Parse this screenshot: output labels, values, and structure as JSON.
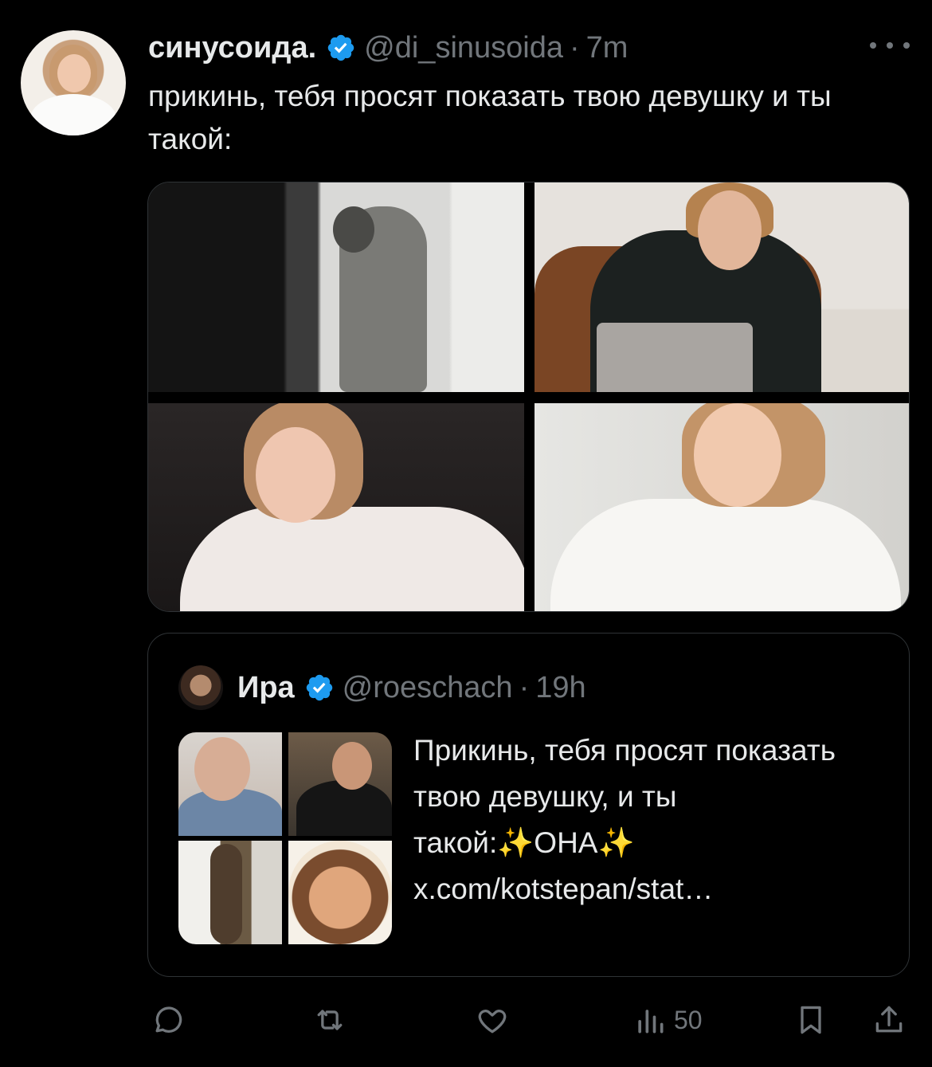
{
  "tweet": {
    "display_name": "синусоида.",
    "handle": "@di_sinusoida",
    "separator": "·",
    "time": "7m",
    "text": "прикинь, тебя просят показать твою девушку и ты такой:",
    "verified": true,
    "more_icon": "more-dots-icon"
  },
  "quote": {
    "display_name": "Ира",
    "handle": "@roeschach",
    "separator": "·",
    "time": "19h",
    "verified": true,
    "text": "Прикинь, тебя просят показать твою девушку, и ты такой:✨ОНА✨ x.com/kotstepan/stat…"
  },
  "actions": {
    "reply_icon": "reply-icon",
    "retweet_icon": "retweet-icon",
    "like_icon": "heart-icon",
    "views_icon": "views-icon",
    "views_count": "50",
    "bookmark_icon": "bookmark-icon",
    "share_icon": "share-icon"
  },
  "colors": {
    "background": "#000000",
    "text": "#e7e9ea",
    "secondary": "#71767b",
    "verified_blue": "#1d9bf0",
    "border": "#2f3336"
  }
}
